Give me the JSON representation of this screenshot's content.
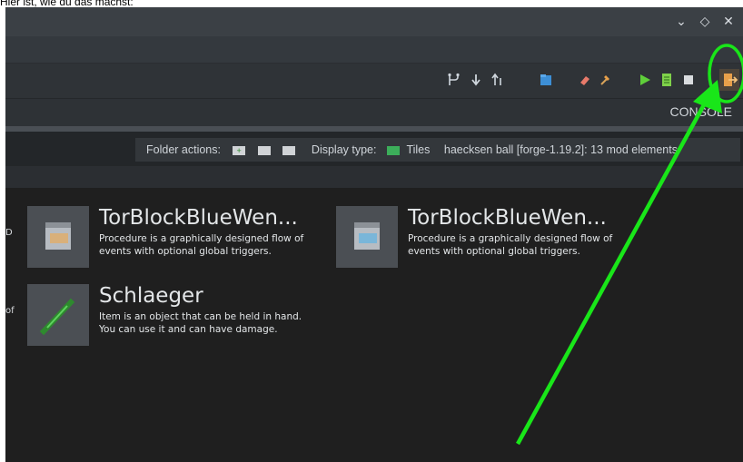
{
  "caption": "Hier ist, wie du das machst:",
  "window": {
    "controls": {
      "minimize": "⌄",
      "maximize": "◇",
      "close": "✕"
    }
  },
  "toolbar": {
    "icons": [
      "branch-icon",
      "arrow-down-icon",
      "sort-up-icon",
      "folder-blue-icon",
      "eraser-icon",
      "hammer-icon",
      "run-icon",
      "build-file-icon",
      "stop-icon",
      "export-icon"
    ]
  },
  "console": {
    "label": "CONSOLE"
  },
  "infobar": {
    "folder_actions_label": "Folder actions:",
    "display_type_label": "Display type:",
    "display_type_value": "Tiles",
    "workspace_summary": "haecksen ball [forge-1.19.2]: 13 mod elements"
  },
  "left_cutoff": {
    "row1": "D",
    "row2": "of"
  },
  "tiles": [
    {
      "title": "TorBlockBlueWen...",
      "description": "Procedure is a graphically designed flow of\nevents with optional global triggers.",
      "icon": "procedure-file-icon-orange"
    },
    {
      "title": "TorBlockBlueWen...",
      "description": "Procedure is a graphically designed flow of\nevents with optional global triggers.",
      "icon": "procedure-file-icon-blue"
    },
    {
      "title": "Schlaeger",
      "description": "Item is an object that can be held in hand.\nYou can use it and can have damage.",
      "icon": "green-stick-item-icon"
    }
  ],
  "colors": {
    "annotation": "#19e619",
    "accent_orange": "#e8a04a",
    "run_green": "#5fcf3a"
  }
}
